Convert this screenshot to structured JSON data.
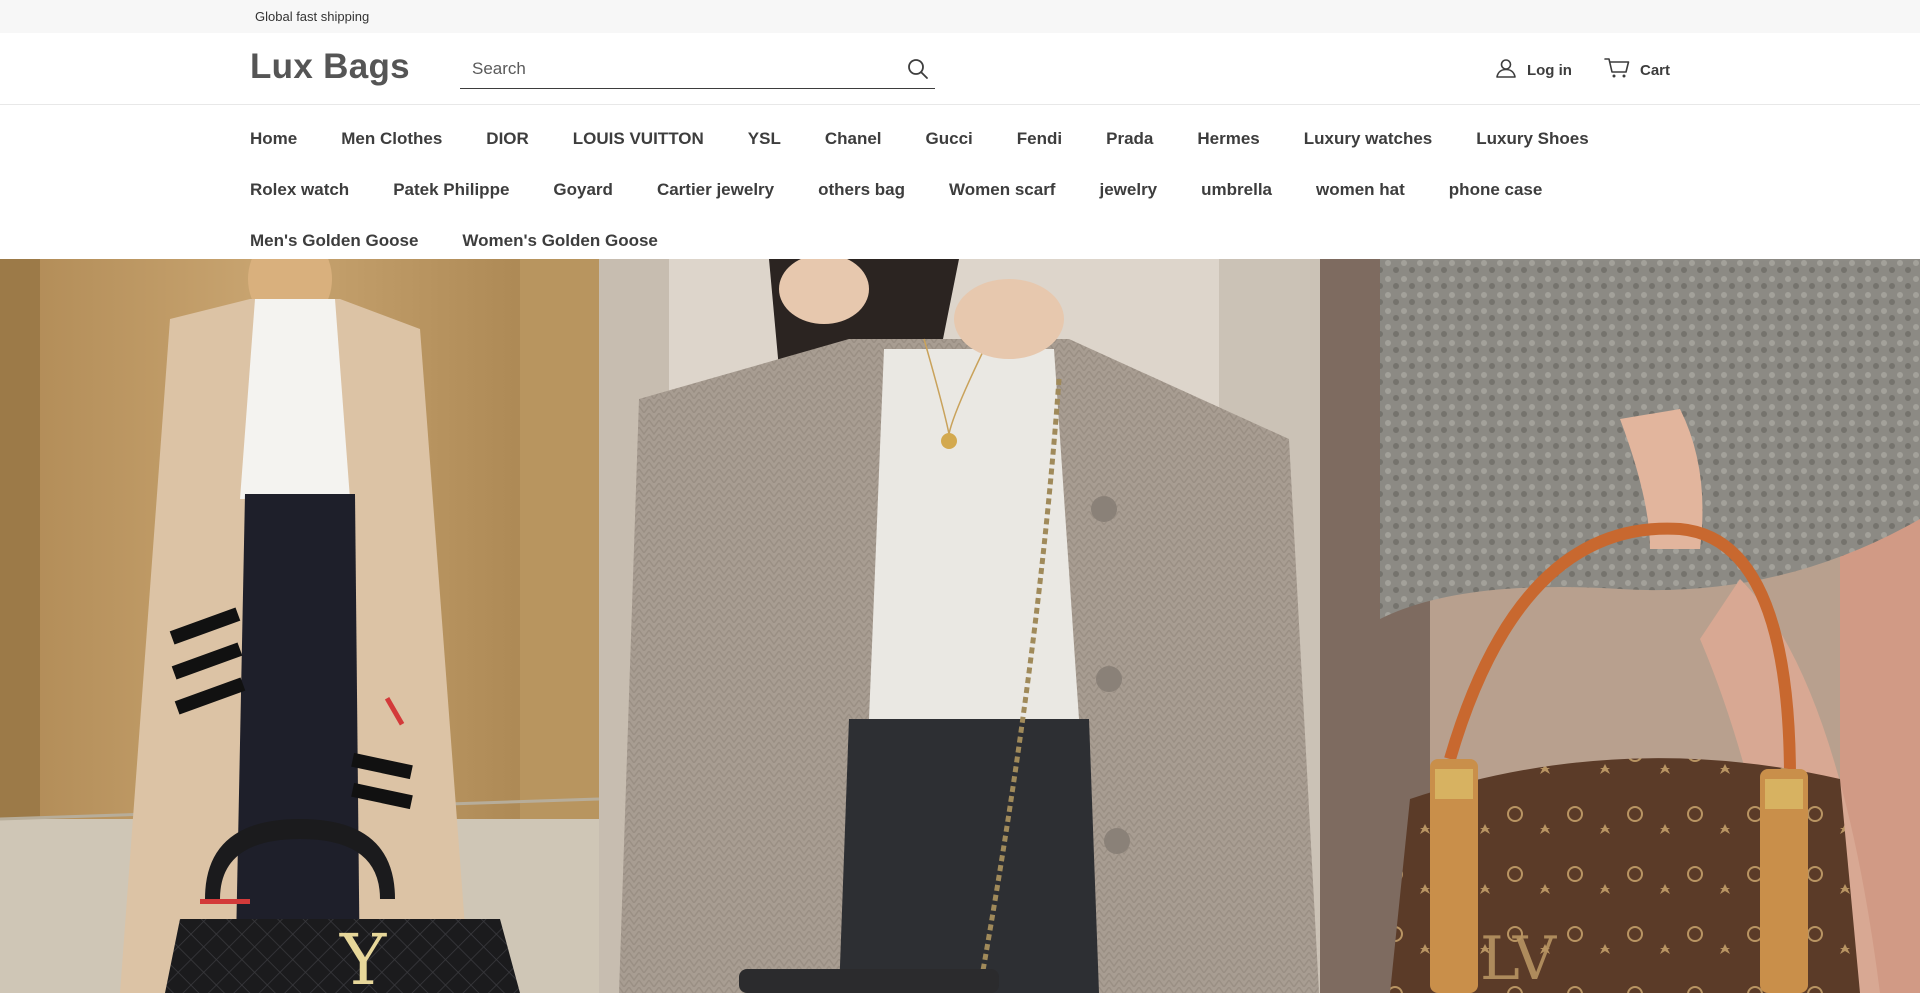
{
  "announcement": {
    "text": "Global fast shipping"
  },
  "header": {
    "logo": "Lux Bags",
    "search": {
      "placeholder": "Search",
      "value": ""
    },
    "login_label": "Log in",
    "cart_label": "Cart"
  },
  "nav": {
    "rows": [
      [
        "Home",
        "Men Clothes",
        "DIOR",
        "LOUIS VUITTON",
        "YSL",
        "Chanel",
        "Gucci",
        "Fendi",
        "Prada",
        "Hermes",
        "Luxury watches",
        "Luxury Shoes"
      ],
      [
        "Rolex watch",
        "Patek Philippe",
        "Goyard",
        "Cartier jewelry",
        "others bag",
        "Women scarf",
        "jewelry",
        "umbrella",
        "women hat",
        "phone case"
      ],
      [
        "Men's Golden Goose",
        "Women's Golden Goose"
      ]
    ]
  },
  "hero": {
    "panels": [
      {
        "name": "hero-image-left",
        "palette": "beige-striped-cardigan-black-tote"
      },
      {
        "name": "hero-image-center",
        "palette": "grey-knit-cardigan-white-tee"
      },
      {
        "name": "hero-image-right",
        "palette": "monogram-handbag-grey-dress"
      }
    ]
  },
  "colors": {
    "text": "#3d3d3d",
    "announcement_bg": "#f7f7f7",
    "logo": "#555555"
  }
}
